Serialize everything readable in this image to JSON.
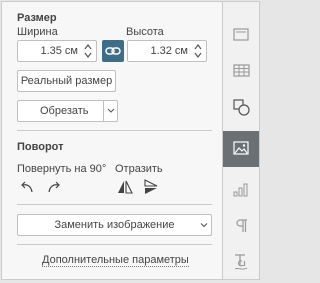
{
  "size": {
    "title": "Размер",
    "width_label": "Ширина",
    "height_label": "Высота",
    "width_value": "1.35 см",
    "height_value": "1.32 см",
    "actual_size_label": "Реальный размер",
    "crop_label": "Обрезать"
  },
  "rotation": {
    "title": "Поворот",
    "rotate_label": "Повернуть на 90°",
    "flip_label": "Отразить"
  },
  "replace_label": "Заменить изображение",
  "advanced_label": "Дополнительные параметры",
  "rail": {
    "icons": [
      "slide-settings-icon",
      "table-settings-icon",
      "shape-settings-icon",
      "image-settings-icon",
      "chart-settings-icon",
      "paragraph-settings-icon",
      "text-art-settings-icon"
    ],
    "active": "image-settings-icon"
  },
  "colors": {
    "accent": "#3f6c86",
    "active_rail": "#6b7074"
  }
}
